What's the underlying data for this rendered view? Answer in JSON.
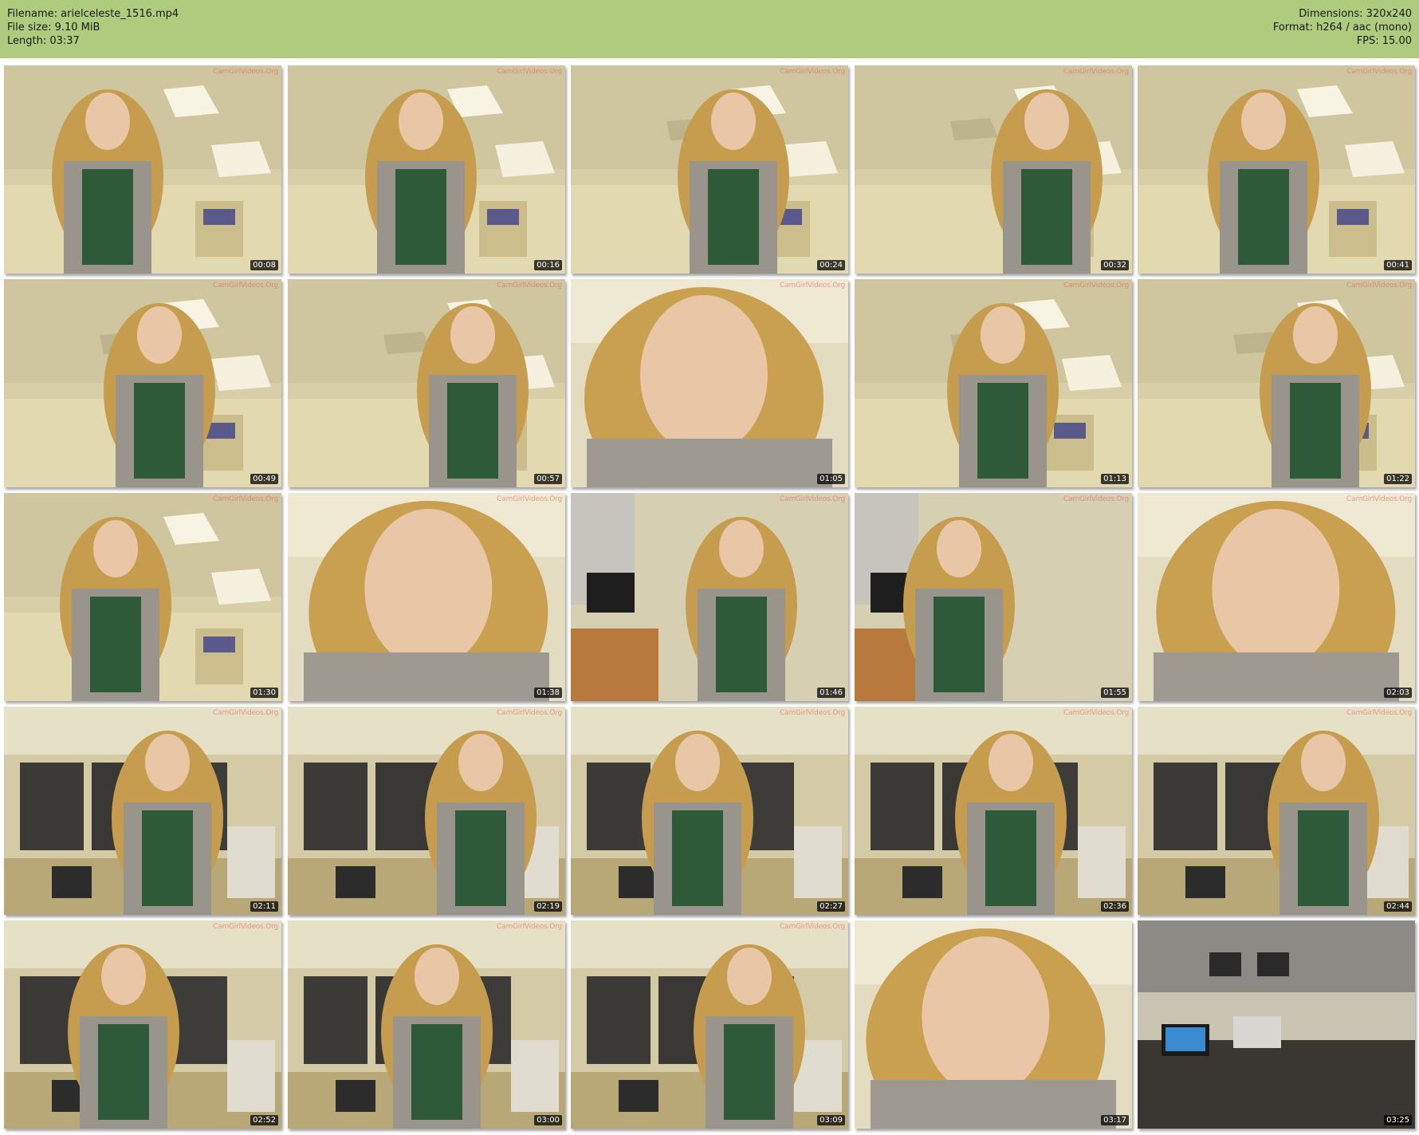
{
  "header": {
    "filename": "Filename: arielceleste_1516.mp4",
    "file_size": "File size: 9.10 MiB",
    "length": "Length: 03:37",
    "dimensions": "Dimensions: 320x240",
    "format": "Format: h264 / aac (mono)",
    "fps": "FPS: 15.00"
  },
  "colors": {
    "header_bg": "#aecb7e",
    "timestamp_bg": "#000000",
    "watermark": "#e65a5a"
  },
  "thumbnails": [
    {
      "time": "00:08",
      "watermark": "CamGirlVideos.Org",
      "scene": "office-ceiling"
    },
    {
      "time": "00:16",
      "watermark": "CamGirlVideos.Org",
      "scene": "office-ceiling"
    },
    {
      "time": "00:24",
      "watermark": "CamGirlVideos.Org",
      "scene": "office-ceiling"
    },
    {
      "time": "00:32",
      "watermark": "CamGirlVideos.Org",
      "scene": "office-ceiling"
    },
    {
      "time": "00:41",
      "watermark": "CamGirlVideos.Org",
      "scene": "office-ceiling"
    },
    {
      "time": "00:49",
      "watermark": "CamGirlVideos.Org",
      "scene": "office-ceiling"
    },
    {
      "time": "00:57",
      "watermark": "CamGirlVideos.Org",
      "scene": "office-ceiling"
    },
    {
      "time": "01:05",
      "watermark": "CamGirlVideos.Org",
      "scene": "closeup"
    },
    {
      "time": "01:13",
      "watermark": "CamGirlVideos.Org",
      "scene": "office-ceiling"
    },
    {
      "time": "01:22",
      "watermark": "CamGirlVideos.Org",
      "scene": "office-ceiling"
    },
    {
      "time": "01:30",
      "watermark": "CamGirlVideos.Org",
      "scene": "office-ceiling"
    },
    {
      "time": "01:38",
      "watermark": "CamGirlVideos.Org",
      "scene": "closeup"
    },
    {
      "time": "01:46",
      "watermark": "CamGirlVideos.Org",
      "scene": "desk"
    },
    {
      "time": "01:55",
      "watermark": "CamGirlVideos.Org",
      "scene": "desk"
    },
    {
      "time": "02:03",
      "watermark": "CamGirlVideos.Org",
      "scene": "closeup"
    },
    {
      "time": "02:11",
      "watermark": "CamGirlVideos.Org",
      "scene": "office-windows"
    },
    {
      "time": "02:19",
      "watermark": "CamGirlVideos.Org",
      "scene": "office-windows"
    },
    {
      "time": "02:27",
      "watermark": "CamGirlVideos.Org",
      "scene": "office-windows"
    },
    {
      "time": "02:36",
      "watermark": "CamGirlVideos.Org",
      "scene": "office-windows"
    },
    {
      "time": "02:44",
      "watermark": "CamGirlVideos.Org",
      "scene": "office-windows"
    },
    {
      "time": "02:52",
      "watermark": "CamGirlVideos.Org",
      "scene": "office-windows"
    },
    {
      "time": "03:00",
      "watermark": "CamGirlVideos.Org",
      "scene": "office-windows"
    },
    {
      "time": "03:09",
      "watermark": "CamGirlVideos.Org",
      "scene": "office-windows"
    },
    {
      "time": "03:17",
      "watermark": "",
      "scene": "closeup"
    },
    {
      "time": "03:25",
      "watermark": "",
      "scene": "table"
    }
  ]
}
